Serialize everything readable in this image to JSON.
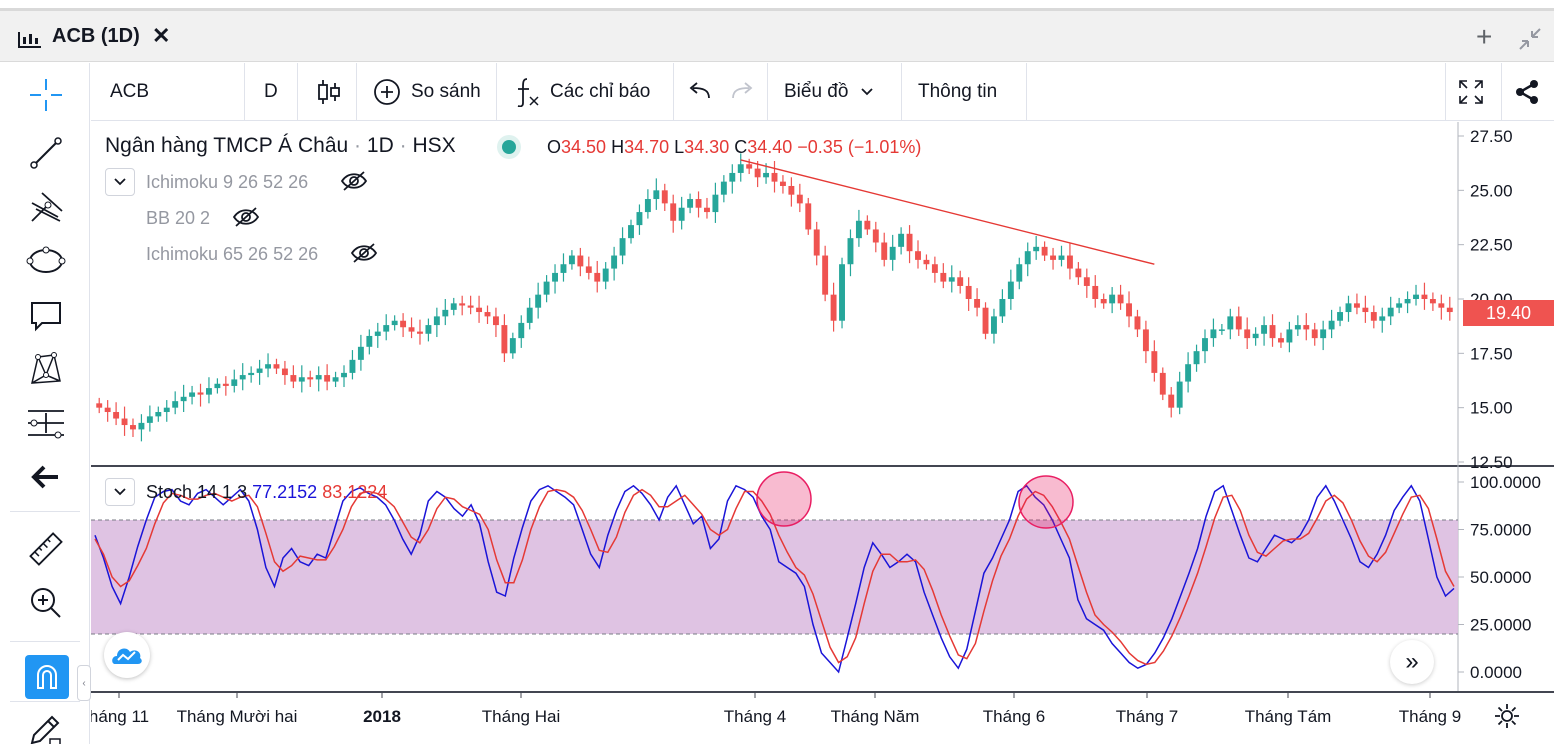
{
  "window": {
    "title": "ACB (1D)",
    "close_glyph": "✕",
    "add_glyph": "+",
    "icons": [
      "chart-icon",
      "close-icon",
      "plus-icon",
      "collapse-icon"
    ]
  },
  "toolbar": {
    "symbol": "ACB",
    "interval": "D",
    "compare_label": "So sánh",
    "indicators_label": "Các chỉ báo",
    "chart_type_label": "Biểu đồ",
    "info_label": "Thông tin",
    "icons": [
      "candles-icon",
      "plus-circle-icon",
      "fx-icon",
      "undo-icon",
      "redo-icon",
      "chevron-down-icon",
      "fullscreen-icon",
      "share-icon"
    ]
  },
  "left_tools": [
    "crosshair-icon",
    "trend-line-icon",
    "pitchfork-icon",
    "ellipse-icon",
    "callout-icon",
    "pattern-icon",
    "measure-lines-icon",
    "back-arrow-icon",
    "ruler-icon",
    "zoom-in-icon",
    "magnet-icon",
    "pencil-lock-icon"
  ],
  "legend": {
    "name": "Ngân hàng TMCP Á Châu",
    "sep1": "·",
    "tf": "1D",
    "sep2": "·",
    "exchange": "HSX",
    "o_label": "O",
    "o_val": "34.50",
    "h_label": "H",
    "h_val": "34.70",
    "l_label": "L",
    "l_val": "34.30",
    "c_label": "C",
    "c_val": "34.40",
    "change": "−0.35 (−1.01%)"
  },
  "indicators": [
    {
      "label": "Ichimoku 9 26 52 26"
    },
    {
      "label": "BB 20 2"
    },
    {
      "label": "Ichimoku 65 26 52 26"
    }
  ],
  "stoch": {
    "label": "Stoch 14 1 3",
    "k_val": "77.2152",
    "d_val": "83.1224",
    "k_color": "#1a14d8",
    "d_color": "#e53935",
    "band_color": "#dcbde0"
  },
  "price_scale": [
    "27.50",
    "25.00",
    "22.50",
    "20.00",
    "17.50",
    "15.00",
    "12.50"
  ],
  "last_price": "19.40",
  "stoch_scale": [
    "100.0000",
    "75.0000",
    "50.0000",
    "25.0000",
    "0.0000"
  ],
  "time_axis": [
    "háng 11",
    "Tháng Mười hai",
    "2018",
    "Tháng Hai",
    "Tháng 4",
    "Tháng Năm",
    "Tháng 6",
    "Tháng 7",
    "Tháng Tám",
    "Tháng 9"
  ],
  "colors": {
    "up": "#26a69a",
    "down": "#ef5350",
    "trendline": "#e53935",
    "ellipse": "#e91e63"
  },
  "chart_data": {
    "type": "candlestick",
    "series_close": [
      15.0,
      14.8,
      14.5,
      14.2,
      14.0,
      14.3,
      14.6,
      14.8,
      15.0,
      15.3,
      15.5,
      15.7,
      15.6,
      15.9,
      16.1,
      16.0,
      16.3,
      16.5,
      16.6,
      16.8,
      17.0,
      16.8,
      16.5,
      16.2,
      16.4,
      16.3,
      16.5,
      16.2,
      16.4,
      16.6,
      17.2,
      17.8,
      18.3,
      18.5,
      18.8,
      19.0,
      18.7,
      18.5,
      18.4,
      18.8,
      19.2,
      19.5,
      19.8,
      19.7,
      19.6,
      19.4,
      19.2,
      18.8,
      17.5,
      18.2,
      18.9,
      19.6,
      20.2,
      20.8,
      21.2,
      21.6,
      22.0,
      21.5,
      21.2,
      20.8,
      21.4,
      22.0,
      22.8,
      23.4,
      24.0,
      24.6,
      25.0,
      24.4,
      23.6,
      24.2,
      24.6,
      24.2,
      24.0,
      24.8,
      25.4,
      25.8,
      26.2,
      26.0,
      25.6,
      25.8,
      25.4,
      25.2,
      24.8,
      24.4,
      23.2,
      22.0,
      20.2,
      19.0,
      21.6,
      22.8,
      23.6,
      23.2,
      22.6,
      21.8,
      22.4,
      23.0,
      22.2,
      21.8,
      21.6,
      21.2,
      20.8,
      21.0,
      20.6,
      20.0,
      19.6,
      18.4,
      19.2,
      20.0,
      20.8,
      21.6,
      22.2,
      22.4,
      22.0,
      21.8,
      22.0,
      21.4,
      21.0,
      20.6,
      20.0,
      19.8,
      20.2,
      19.8,
      19.2,
      18.6,
      17.6,
      16.6,
      15.6,
      15.0,
      16.2,
      17.0,
      17.6,
      18.2,
      18.6,
      18.6,
      19.2,
      18.6,
      18.2,
      18.4,
      18.8,
      18.2,
      18.0,
      18.6,
      18.8,
      18.6,
      18.2,
      18.6,
      19.0,
      19.4,
      19.8,
      19.6,
      19.4,
      19.0,
      19.2,
      19.6,
      19.8,
      20.0,
      20.2,
      20.0,
      19.8,
      19.6,
      19.4
    ],
    "stoch_k": [
      72,
      60,
      45,
      36,
      50,
      66,
      80,
      92,
      95,
      96,
      90,
      88,
      94,
      96,
      92,
      88,
      92,
      96,
      90,
      75,
      55,
      45,
      60,
      65,
      58,
      56,
      62,
      60,
      75,
      90,
      95,
      97,
      94,
      92,
      88,
      80,
      70,
      62,
      72,
      90,
      95,
      92,
      86,
      82,
      88,
      78,
      58,
      42,
      40,
      60,
      76,
      90,
      96,
      98,
      95,
      92,
      88,
      75,
      62,
      55,
      72,
      85,
      95,
      98,
      94,
      88,
      80,
      92,
      98,
      88,
      78,
      82,
      65,
      70,
      90,
      98,
      96,
      92,
      82,
      75,
      58,
      55,
      52,
      45,
      25,
      10,
      5,
      0,
      18,
      36,
      55,
      68,
      62,
      55,
      58,
      62,
      58,
      42,
      30,
      18,
      8,
      2,
      12,
      32,
      52,
      60,
      70,
      80,
      95,
      98,
      92,
      88,
      80,
      70,
      60,
      38,
      28,
      25,
      22,
      15,
      10,
      5,
      2,
      4,
      10,
      18,
      28,
      40,
      52,
      65,
      82,
      95,
      98,
      85,
      72,
      60,
      58,
      65,
      72,
      70,
      68,
      72,
      80,
      92,
      98,
      90,
      80,
      70,
      58,
      55,
      62,
      72,
      85,
      92,
      98,
      90,
      70,
      50,
      40,
      44
    ],
    "stoch_d": [
      70,
      62,
      50,
      45,
      48,
      56,
      65,
      78,
      89,
      94,
      93,
      91,
      91,
      93,
      94,
      92,
      90,
      92,
      93,
      87,
      73,
      58,
      53,
      56,
      61,
      60,
      59,
      59,
      66,
      75,
      87,
      94,
      95,
      94,
      91,
      87,
      79,
      71,
      68,
      75,
      86,
      92,
      91,
      87,
      85,
      83,
      75,
      59,
      47,
      47,
      59,
      75,
      87,
      95,
      96,
      95,
      92,
      85,
      75,
      64,
      63,
      71,
      84,
      93,
      96,
      93,
      87,
      87,
      90,
      93,
      88,
      83,
      75,
      72,
      75,
      86,
      95,
      95,
      90,
      83,
      72,
      63,
      55,
      51,
      41,
      27,
      13,
      5,
      8,
      18,
      36,
      53,
      62,
      62,
      58,
      58,
      59,
      54,
      43,
      30,
      19,
      9,
      7,
      15,
      32,
      48,
      61,
      70,
      82,
      91,
      95,
      93,
      87,
      79,
      70,
      56,
      42,
      30,
      25,
      21,
      16,
      10,
      6,
      4,
      5,
      11,
      19,
      29,
      40,
      52,
      66,
      81,
      92,
      93,
      85,
      72,
      63,
      61,
      65,
      69,
      70,
      70,
      73,
      81,
      90,
      93,
      89,
      80,
      69,
      61,
      58,
      63,
      73,
      83,
      92,
      93,
      86,
      70,
      53,
      45
    ]
  }
}
